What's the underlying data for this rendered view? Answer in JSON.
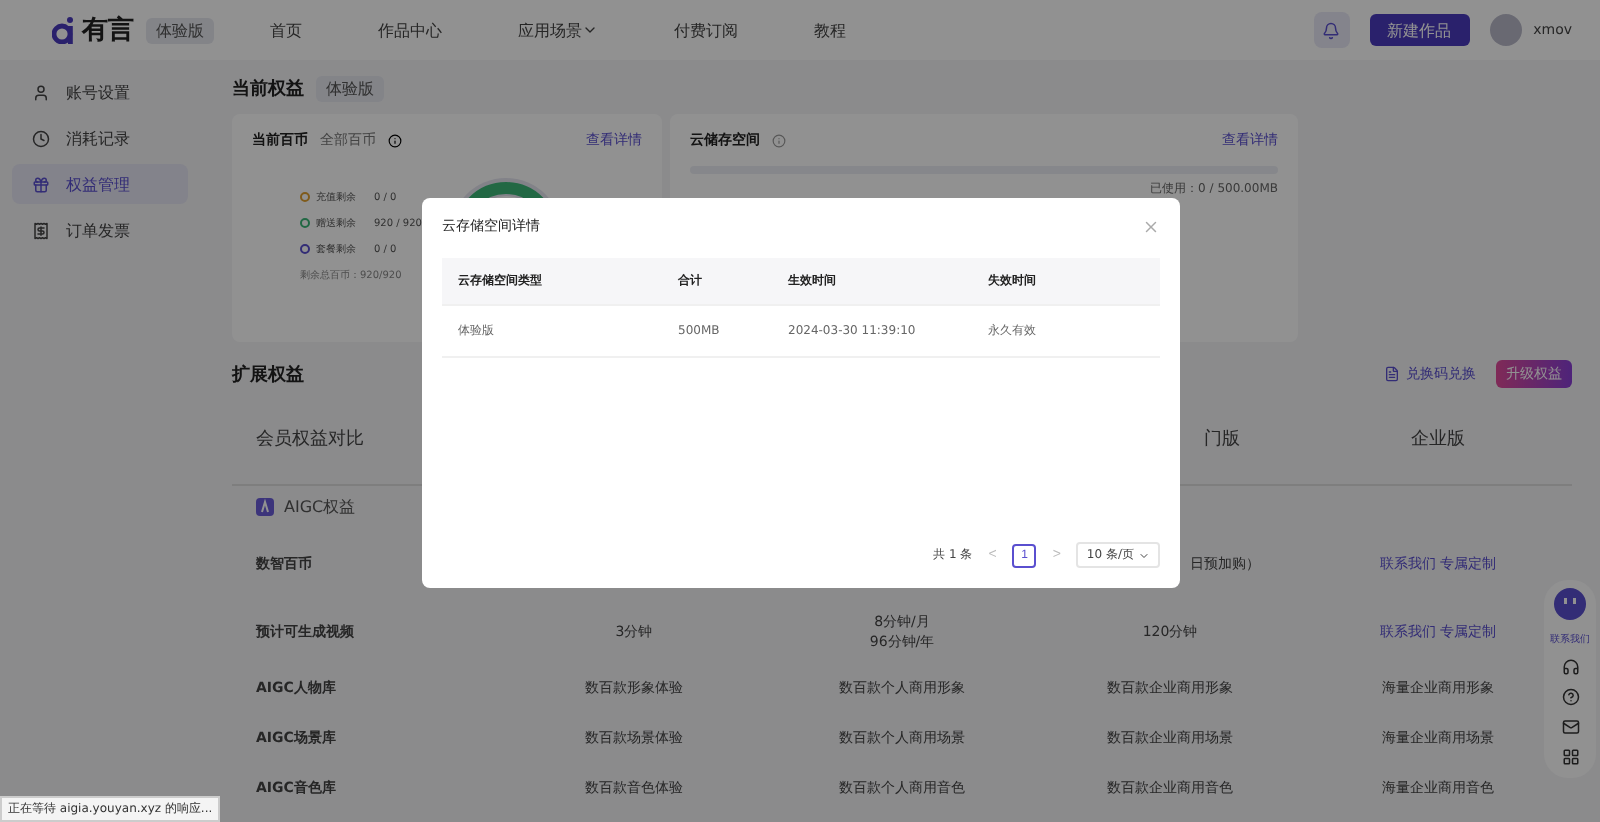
{
  "header": {
    "logo": "有言",
    "edition_badge": "体验版",
    "nav": [
      {
        "label": "首页",
        "dropdown": false
      },
      {
        "label": "作品中心",
        "dropdown": false
      },
      {
        "label": "应用场景",
        "dropdown": true
      },
      {
        "label": "付费订阅",
        "dropdown": false
      },
      {
        "label": "教程",
        "dropdown": false
      }
    ],
    "new_button": "新建作品",
    "username": "xmov"
  },
  "sidebar": {
    "items": [
      {
        "label": "账号设置",
        "selected": false
      },
      {
        "label": "消耗记录",
        "selected": false
      },
      {
        "label": "权益管理",
        "selected": true
      },
      {
        "label": "订单发票",
        "selected": false
      }
    ]
  },
  "current": {
    "title": "当前权益",
    "badge": "体验版",
    "coins_card": {
      "title": "当前百币",
      "subtitle": "全部百币",
      "link": "查看详情",
      "legend": [
        {
          "label": "充值剩余",
          "value": "0 / 0"
        },
        {
          "label": "赠送剩余",
          "value": "920 / 920"
        },
        {
          "label": "套餐剩余",
          "value": "0 / 0"
        }
      ],
      "total_label": "剩余总百币：",
      "total_value": "920/920"
    },
    "storage_card": {
      "title": "云储存空间",
      "link": "查看详情",
      "used": "已使用：0 / 500.00MB"
    }
  },
  "extended": {
    "title": "扩展权益",
    "redeem_link": "兑换码兑换",
    "upgrade_button": "升级权益",
    "table": {
      "columns": [
        {
          "text": "会员权益对比",
          "kind": "title"
        },
        {
          "kind": "covered"
        },
        {
          "kind": "covered"
        },
        {
          "text": "门版",
          "kind": "partial"
        },
        {
          "text": "企业版",
          "kind": "plan"
        }
      ],
      "section": "AIGC权益",
      "rows": [
        {
          "cells": [
            {
              "text": "数智百币",
              "kind": "label"
            },
            {
              "kind": "covered"
            },
            {
              "kind": "covered"
            },
            {
              "text": "日预加购）",
              "kind": "partial"
            },
            {
              "text": "联系我们 专属定制",
              "kind": "link"
            }
          ]
        },
        {
          "cells": [
            {
              "text": "预计可生成视频",
              "kind": "label"
            },
            {
              "text": "3分钟",
              "kind": "text"
            },
            {
              "text": "8分钟/月\n96分钟/年",
              "kind": "text"
            },
            {
              "text": "120分钟",
              "kind": "text"
            },
            {
              "text": "联系我们 专属定制",
              "kind": "link"
            }
          ]
        },
        {
          "cells": [
            {
              "text": "AIGC人物库",
              "kind": "label"
            },
            {
              "text": "数百款形象体验",
              "kind": "text"
            },
            {
              "text": "数百款个人商用形象",
              "kind": "text"
            },
            {
              "text": "数百款企业商用形象",
              "kind": "text"
            },
            {
              "text": "海量企业商用形象",
              "kind": "text"
            }
          ]
        },
        {
          "cells": [
            {
              "text": "AIGC场景库",
              "kind": "label"
            },
            {
              "text": "数百款场景体验",
              "kind": "text"
            },
            {
              "text": "数百款个人商用场景",
              "kind": "text"
            },
            {
              "text": "数百款企业商用场景",
              "kind": "text"
            },
            {
              "text": "海量企业商用场景",
              "kind": "text"
            }
          ]
        },
        {
          "cells": [
            {
              "text": "AIGC音色库",
              "kind": "label"
            },
            {
              "text": "数百款音色体验",
              "kind": "text"
            },
            {
              "text": "数百款个人商用音色",
              "kind": "text"
            },
            {
              "text": "数百款企业商用音色",
              "kind": "text"
            },
            {
              "text": "海量企业商用音色",
              "kind": "text"
            }
          ]
        }
      ]
    }
  },
  "float_bar": {
    "contact_label": "联系我们"
  },
  "status_bar": "正在等待 aigia.youyan.xyz 的响应...",
  "modal": {
    "title": "云存储空间详情",
    "columns": [
      "云存储空间类型",
      "合计",
      "生效时间",
      "失效时间"
    ],
    "rows": [
      [
        "体验版",
        "500MB",
        "2024-03-30 11:39:10",
        "永久有效"
      ]
    ],
    "pagination": {
      "total": "共 1 条",
      "prev": "<",
      "pages": [
        {
          "label": "1",
          "selected": true
        }
      ],
      "next": ">",
      "page_size": "10 条/页"
    }
  }
}
